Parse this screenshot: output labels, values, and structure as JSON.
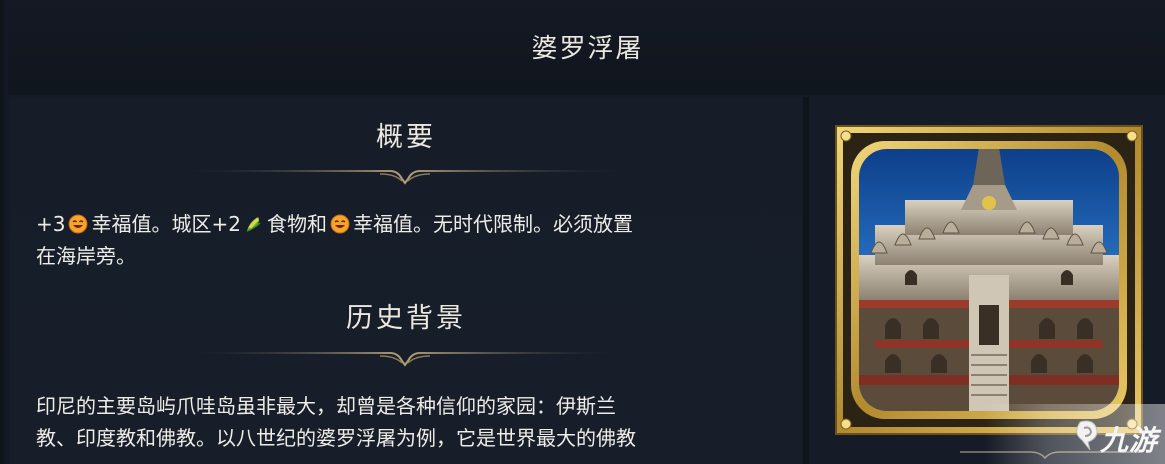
{
  "window": {
    "title": "婆罗浮屠"
  },
  "summary": {
    "heading": "概要",
    "line1_a": "+3",
    "line1_b": "幸福值。城区+2",
    "line1_c": "食物和",
    "line1_d": "幸福值。无时代限制。必须放置",
    "line2": "在海岸旁。"
  },
  "history": {
    "heading": "历史背景",
    "line1": "印尼的主要岛屿爪哇岛虽非最大，却曾是各种信仰的家园：伊斯兰",
    "line2": "教、印度教和佛教。以八世纪的婆罗浮屠为例，它是世界最大的佛教"
  },
  "icons": {
    "amenity": "amenity-smiley-icon",
    "food": "food-corn-icon",
    "portrait": "borobudur-wonder-portrait"
  },
  "watermark": {
    "text": "九游"
  },
  "colors": {
    "background": "#151b26",
    "text": "#eeece6",
    "gold": "#c9a646",
    "sky": "#1c5fb0"
  }
}
